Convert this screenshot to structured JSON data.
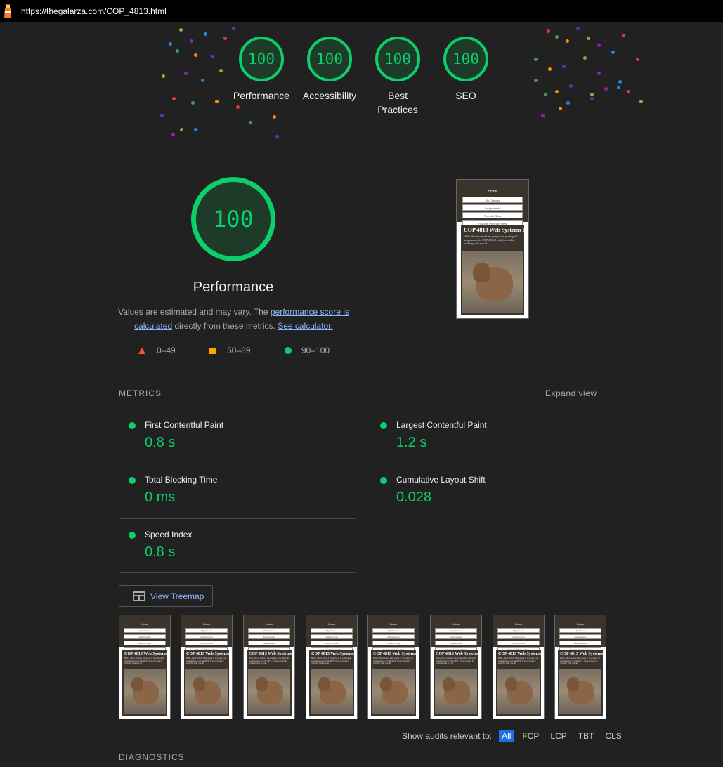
{
  "url": "https://thegalarza.com/COP_4813.html",
  "scores": [
    {
      "score": "100",
      "label": "Performance"
    },
    {
      "score": "100",
      "label": "Accessibility"
    },
    {
      "score": "100",
      "label": "Best Practices"
    },
    {
      "score": "100",
      "label": "SEO"
    }
  ],
  "performance": {
    "score": "100",
    "title": "Performance",
    "desc_prefix": "Values are estimated and may vary. The ",
    "link_score": "performance score is calculated",
    "desc_mid": " directly from these metrics. ",
    "link_calc": "See calculator."
  },
  "legend": {
    "fail": "0–49",
    "average": "50–89",
    "pass": "90–100"
  },
  "colors": {
    "pass": "#0cce6b",
    "average": "#ffa400",
    "fail": "#ff4e42",
    "accent": "#8ab4f8"
  },
  "metrics_header": "METRICS",
  "expand_view": "Expand view",
  "metrics": [
    {
      "name": "First Contentful Paint",
      "value": "0.8 s"
    },
    {
      "name": "Largest Contentful Paint",
      "value": "1.2 s"
    },
    {
      "name": "Total Blocking Time",
      "value": "0 ms"
    },
    {
      "name": "Cumulative Layout Shift",
      "value": "0.028"
    },
    {
      "name": "Speed Index",
      "value": "0.8 s"
    }
  ],
  "treemap_label": "View Treemap",
  "screenshot": {
    "home": "Home",
    "nav": [
      "My Classes",
      "Assignments",
      "Favorite Sites",
      "Favorite Program Sites"
    ],
    "heading": "COP 4813 Web Systems I",
    "text": "Hello, this is where I am going to be posting all assignments for COP 4813. I look forward to working with you all."
  },
  "filter": {
    "label": "Show audits relevant to:",
    "chips": [
      "All",
      "FCP",
      "LCP",
      "TBT",
      "CLS"
    ]
  },
  "diagnostics_header": "DIAGNOSTICS"
}
